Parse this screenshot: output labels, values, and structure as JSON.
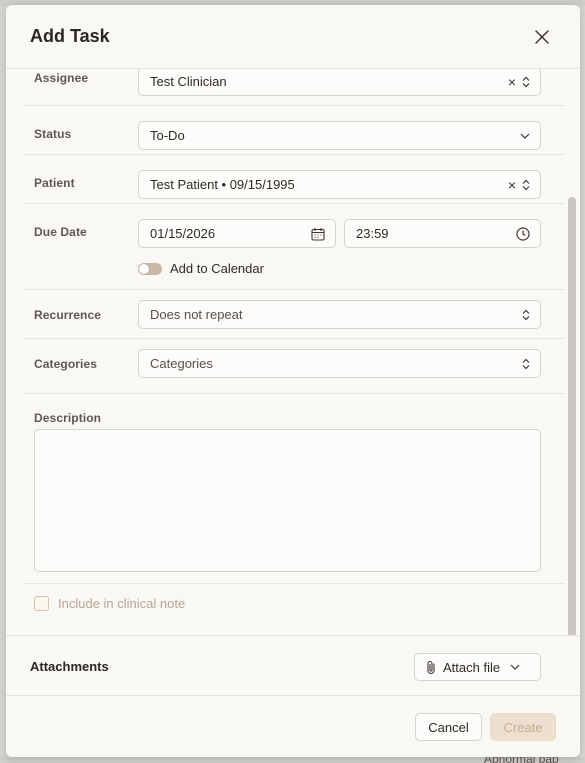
{
  "background": {
    "bottom_fragment": "Abnormal pap"
  },
  "modal": {
    "title": "Add Task",
    "close_icon": "close-icon",
    "fields": {
      "assignee": {
        "label": "Assignee",
        "value": "Test Clinician"
      },
      "status": {
        "label": "Status",
        "value": "To-Do"
      },
      "patient": {
        "label": "Patient",
        "value": "Test Patient • 09/15/1995"
      },
      "due_date": {
        "label": "Due Date",
        "date": "01/15/2026",
        "time": "23:59",
        "calendar_toggle_label": "Add to Calendar",
        "calendar_toggle_on": false
      },
      "recurrence": {
        "label": "Recurrence",
        "value": "Does not repeat"
      },
      "categories": {
        "label": "Categories",
        "placeholder": "Categories"
      },
      "description": {
        "label": "Description",
        "value": ""
      },
      "include_clinical_note": {
        "label": "Include in clinical note",
        "checked": false
      }
    },
    "attachments": {
      "title": "Attachments",
      "attach_label": "Attach file"
    },
    "footer": {
      "cancel_label": "Cancel",
      "create_label": "Create"
    }
  },
  "colors": {
    "accent_disabled": "#eee0d0",
    "toggle_off": "#c9b8a5",
    "modal_bg": "#f9f8f5"
  }
}
